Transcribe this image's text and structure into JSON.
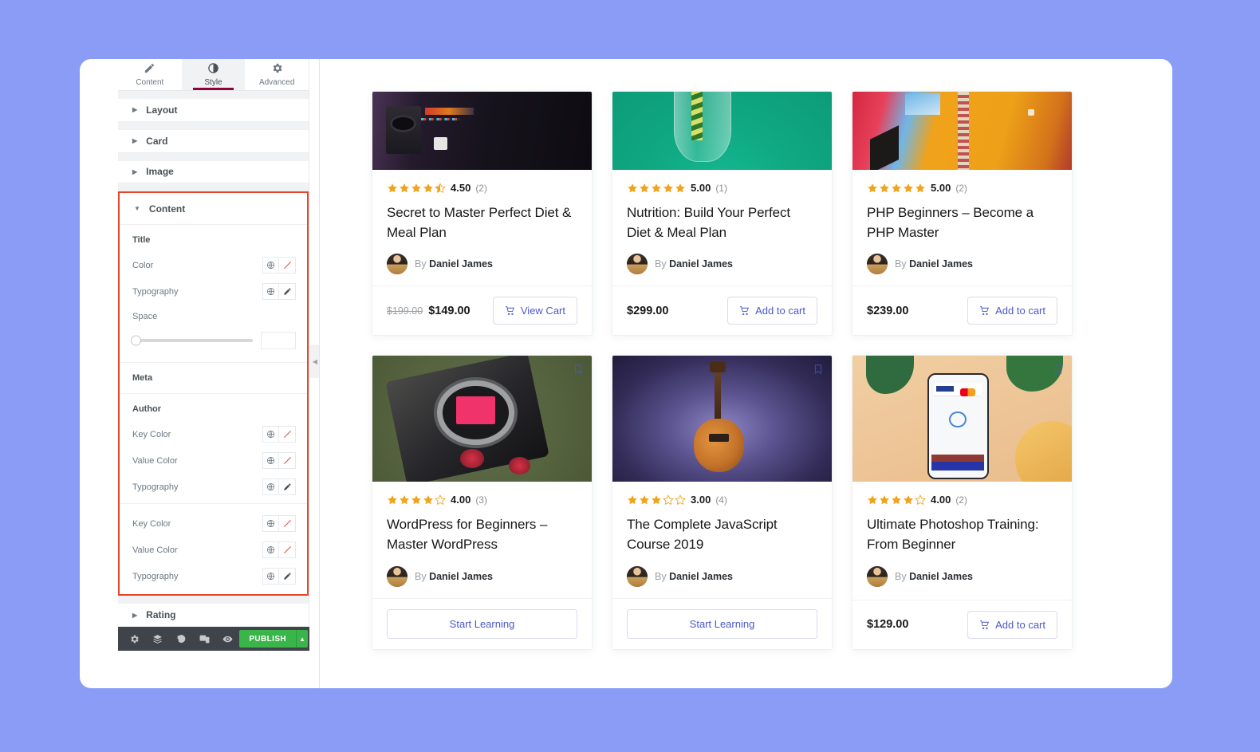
{
  "theme": {
    "page_background": "#8b9cf7",
    "accent_red": "#e8442a",
    "publish_green": "#39b54a",
    "link_blue": "#4a59c9",
    "star_gold": "#f0a31b"
  },
  "panel": {
    "tabs": [
      {
        "label": "Content",
        "icon": "pencil-icon",
        "active": false
      },
      {
        "label": "Style",
        "icon": "contrast-icon",
        "active": true
      },
      {
        "label": "Advanced",
        "icon": "gear-icon",
        "active": false
      }
    ],
    "sections": [
      {
        "label": "Layout",
        "expanded": false
      },
      {
        "label": "Card",
        "expanded": false
      },
      {
        "label": "Image",
        "expanded": false
      },
      {
        "label": "Content",
        "expanded": true
      },
      {
        "label": "Rating",
        "expanded": false
      }
    ],
    "content_section": {
      "title_group": "Title",
      "title_color_label": "Color",
      "title_typography_label": "Typography",
      "space_label": "Space",
      "space_value": "",
      "space_slider_percent": 0,
      "meta_group": "Meta",
      "author_group": "Author",
      "author_key_color_label": "Key Color",
      "author_value_color_label": "Value Color",
      "author_typography_label": "Typography",
      "second_key_color_label": "Key Color",
      "second_value_color_label": "Value Color",
      "second_typography_label": "Typography"
    },
    "toolbar": {
      "icons": [
        "settings-gear-icon",
        "navigator-layers-icon",
        "history-revision-icon",
        "responsive-mode-icon",
        "preview-eye-icon"
      ],
      "publish_label": "PUBLISH",
      "publish_dropdown_icon": "caret-up-icon"
    },
    "collapse_handle_icon": "chevron-left-icon"
  },
  "products": [
    {
      "id": "card-1",
      "image_name": "studio-desk-photo",
      "image_style": "dark",
      "bookmark": false,
      "rating_value": "4.50",
      "rating_count": "(2)",
      "stars_full": 4,
      "stars_half": 1,
      "title": "Secret to Master Perfect Diet & Meal Plan",
      "author_by": "By",
      "author_name": "Daniel James",
      "price_old": "$199.00",
      "price": "$149.00",
      "action_label": "View Cart",
      "action_icon": "cart-icon",
      "action_full_width": false
    },
    {
      "id": "card-2",
      "image_name": "green-glass-photo",
      "image_style": "teal",
      "bookmark": false,
      "rating_value": "5.00",
      "rating_count": "(1)",
      "stars_full": 5,
      "stars_half": 0,
      "title": "Nutrition: Build Your Perfect Diet & Meal Plan",
      "author_by": "By",
      "author_name": "Daniel James",
      "price_old": "",
      "price": "$299.00",
      "action_label": "Add to cart",
      "action_icon": "cart-icon",
      "action_full_width": false
    },
    {
      "id": "card-3",
      "image_name": "colorful-abstract-photo",
      "image_style": "orange",
      "bookmark": false,
      "rating_value": "5.00",
      "rating_count": "(2)",
      "stars_full": 5,
      "stars_half": 0,
      "title": "PHP Beginners – Become a PHP Master",
      "author_by": "By",
      "author_name": "Daniel James",
      "price_old": "",
      "price": "$239.00",
      "action_label": "Add to cart",
      "action_icon": "cart-icon",
      "action_full_width": false
    },
    {
      "id": "card-4",
      "image_name": "vintage-camera-photo",
      "image_style": "olive",
      "bookmark": true,
      "rating_value": "4.00",
      "rating_count": "(3)",
      "stars_full": 4,
      "stars_half": 0,
      "title": "WordPress for Beginners – Master WordPress",
      "author_by": "By",
      "author_name": "Daniel James",
      "price_old": "",
      "price": "",
      "action_label": "Start Learning",
      "action_icon": "",
      "action_full_width": true
    },
    {
      "id": "card-5",
      "image_name": "electric-guitar-photo",
      "image_style": "purple",
      "bookmark": true,
      "rating_value": "3.00",
      "rating_count": "(4)",
      "stars_full": 3,
      "stars_half": 0,
      "title": "The Complete JavaScript Course 2019",
      "author_by": "By",
      "author_name": "Daniel James",
      "price_old": "",
      "price": "",
      "action_label": "Start Learning",
      "action_icon": "",
      "action_full_width": true
    },
    {
      "id": "card-6",
      "image_name": "phone-payment-photo",
      "image_style": "sand",
      "bookmark": true,
      "rating_value": "4.00",
      "rating_count": "(2)",
      "stars_full": 4,
      "stars_half": 0,
      "title": "Ultimate Photoshop Training: From Beginner",
      "author_by": "By",
      "author_name": "Daniel James",
      "price_old": "",
      "price": "$129.00",
      "action_label": "Add to cart",
      "action_icon": "cart-icon",
      "action_full_width": false
    }
  ]
}
